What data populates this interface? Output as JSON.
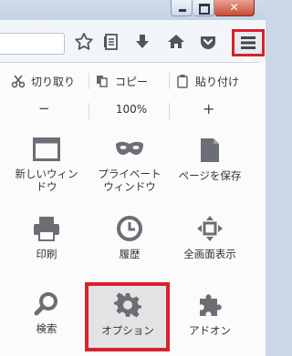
{
  "toolbar": {
    "icons": [
      "star-icon",
      "reading-list-icon",
      "download-icon",
      "home-icon",
      "pocket-icon",
      "hamburger-menu-icon"
    ]
  },
  "edit": {
    "cut": "切り取り",
    "copy": "コピー",
    "paste": "貼り付け"
  },
  "zoom": {
    "minus": "−",
    "value": "100%",
    "plus": "+"
  },
  "grid": [
    {
      "label1": "新しいウィン",
      "label2": "ドウ",
      "icon": "new-window-icon"
    },
    {
      "label1": "プライベート",
      "label2": "ウィンドウ",
      "icon": "private-mask-icon"
    },
    {
      "label1": "ページを保存",
      "label2": "",
      "icon": "save-page-icon"
    },
    {
      "label1": "印刷",
      "label2": "",
      "icon": "print-icon"
    },
    {
      "label1": "履歴",
      "label2": "",
      "icon": "history-clock-icon"
    },
    {
      "label1": "全画面表示",
      "label2": "",
      "icon": "fullscreen-icon"
    },
    {
      "label1": "検索",
      "label2": "",
      "icon": "search-icon"
    },
    {
      "label1": "オプション",
      "label2": "",
      "icon": "gear-icon"
    },
    {
      "label1": "アドオン",
      "label2": "",
      "icon": "puzzle-icon"
    }
  ],
  "colors": {
    "highlight": "#d9202c",
    "icon": "#6b6f75"
  }
}
